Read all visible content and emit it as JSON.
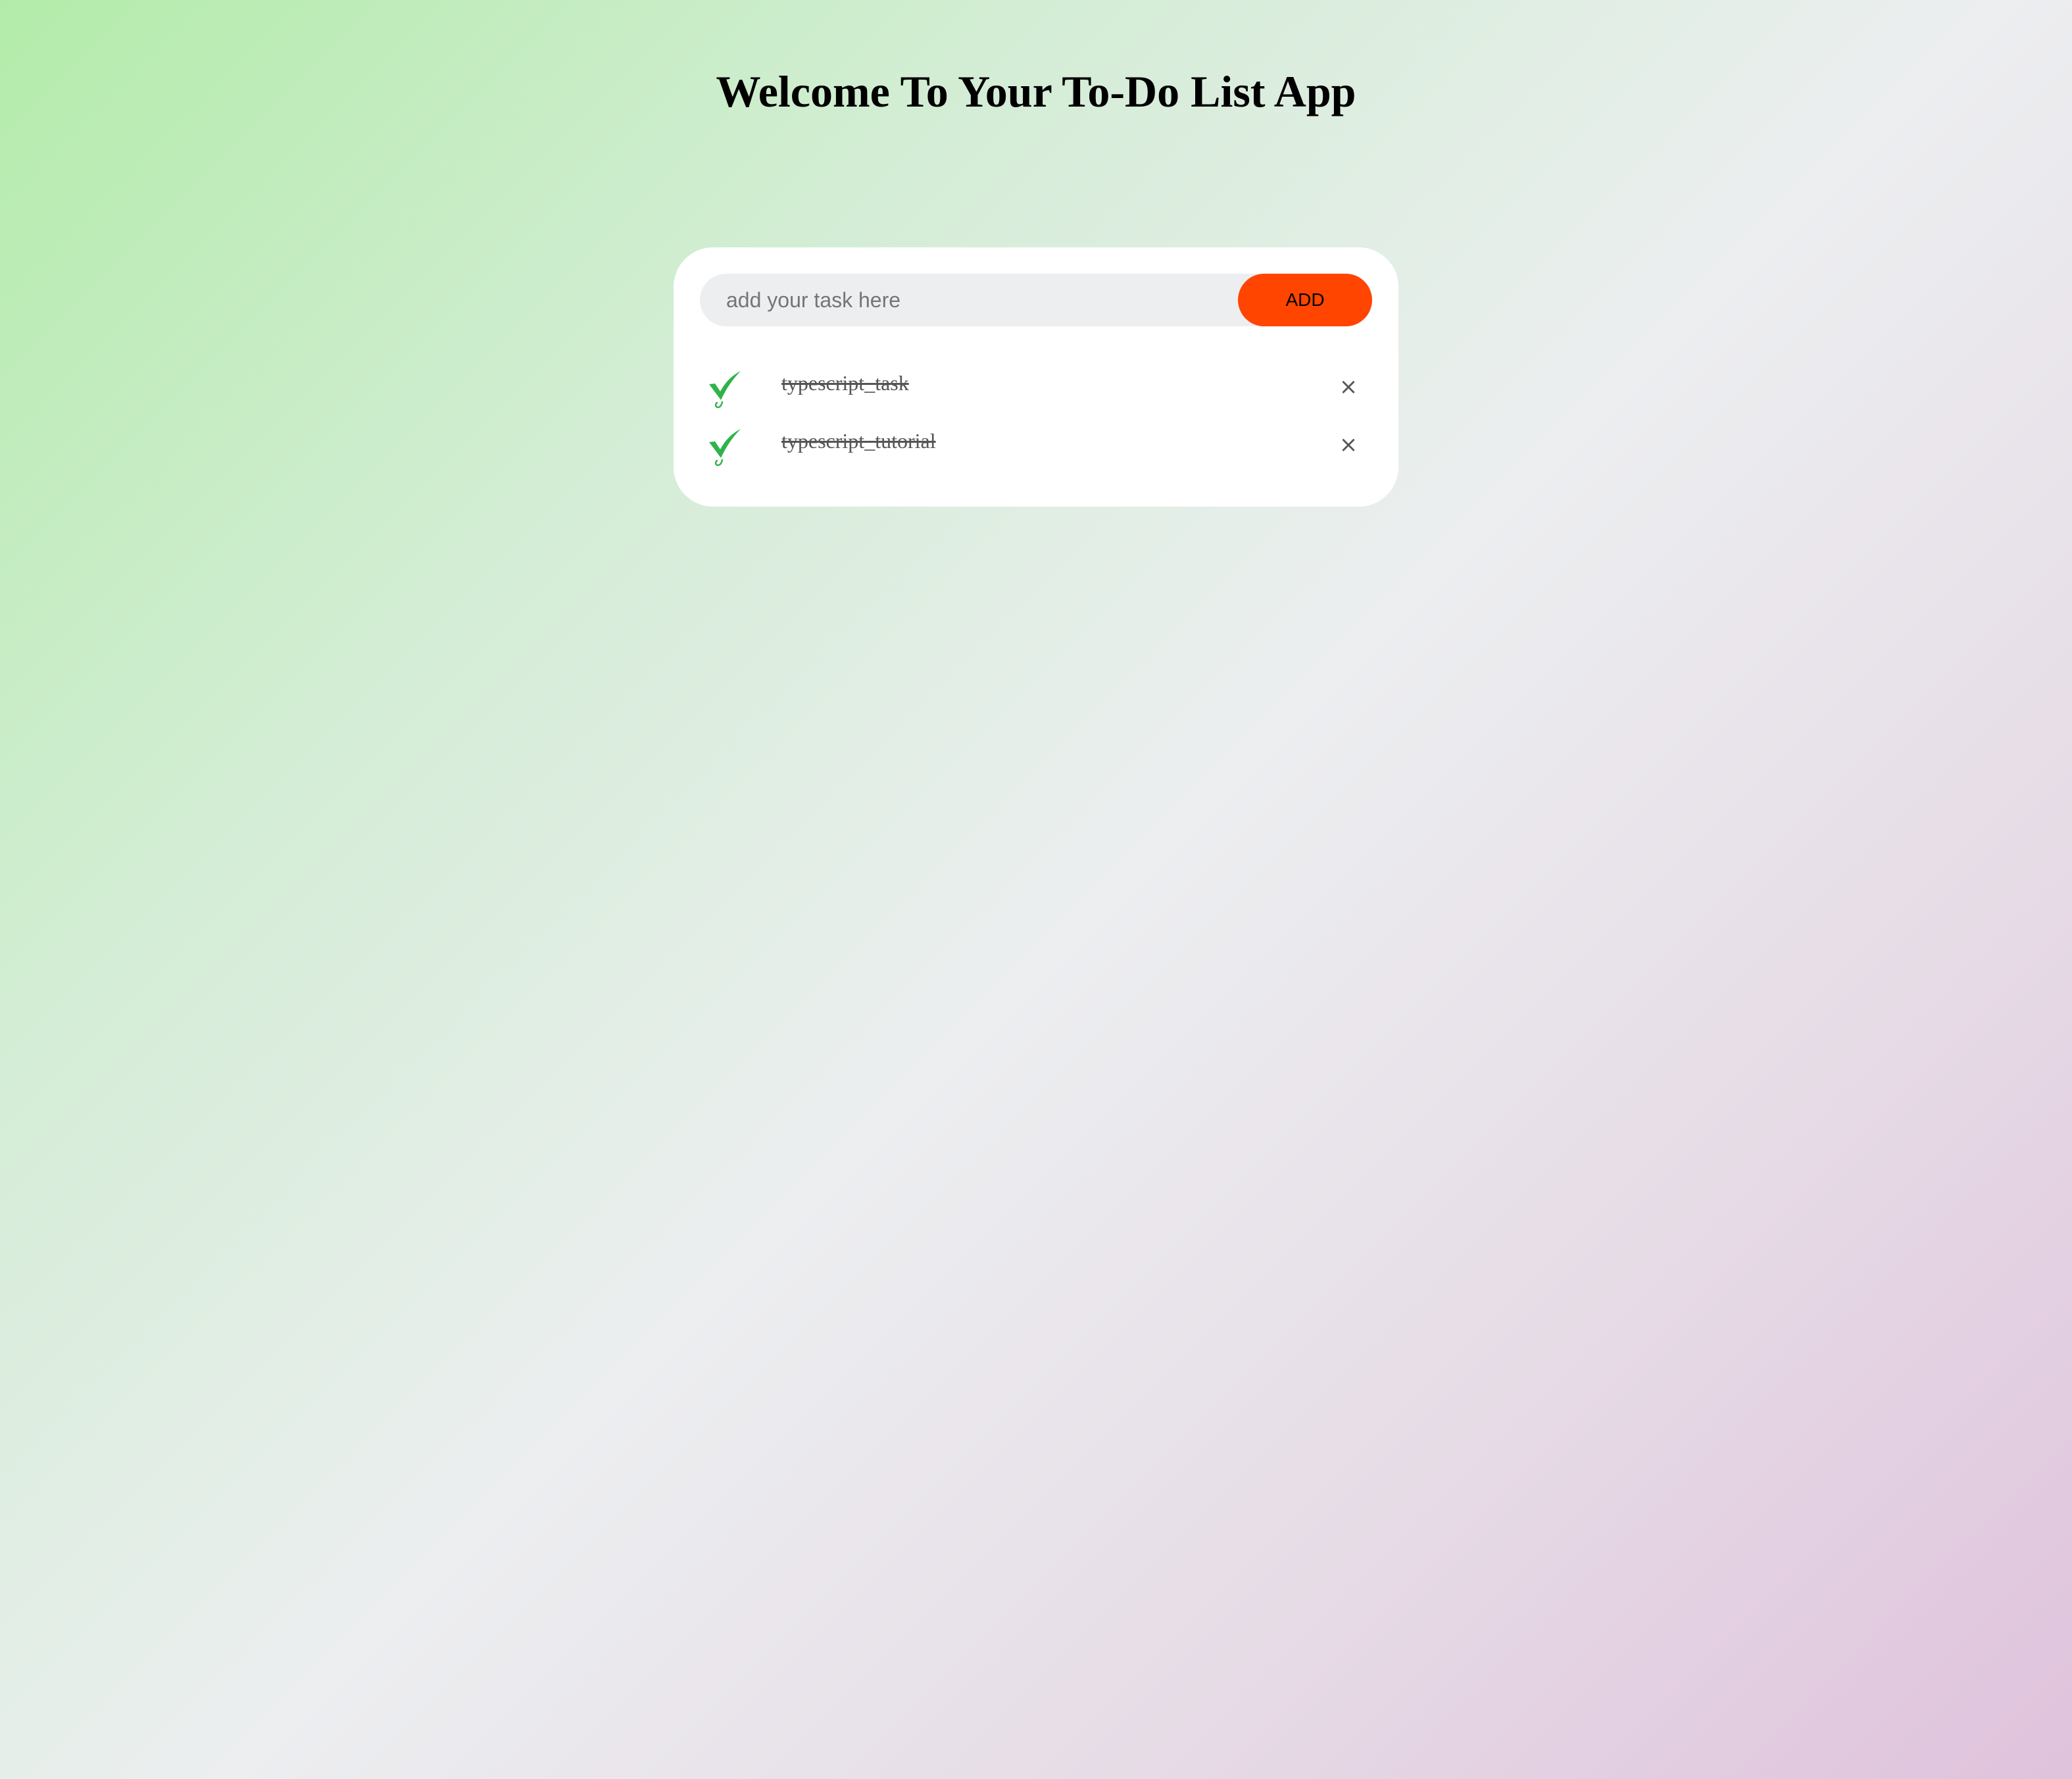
{
  "header": {
    "title": "Welcome To Your To-Do List App"
  },
  "task_input": {
    "placeholder": "add your task here",
    "value": ""
  },
  "add_button": {
    "label": "ADD"
  },
  "tasks": [
    {
      "label": "typescript_task",
      "completed": true,
      "delete_symbol": "×"
    },
    {
      "label": "typescript_tutorial",
      "completed": true,
      "delete_symbol": "×"
    }
  ],
  "icons": {
    "check": "check-icon",
    "delete": "close-icon"
  },
  "colors": {
    "accent": "#ff4500",
    "check": "#2fb34a",
    "input_background": "#edeef0",
    "card_background": "#ffffff",
    "gradient_start": "#b3ecaa",
    "gradient_end": "#dfc2dc"
  }
}
